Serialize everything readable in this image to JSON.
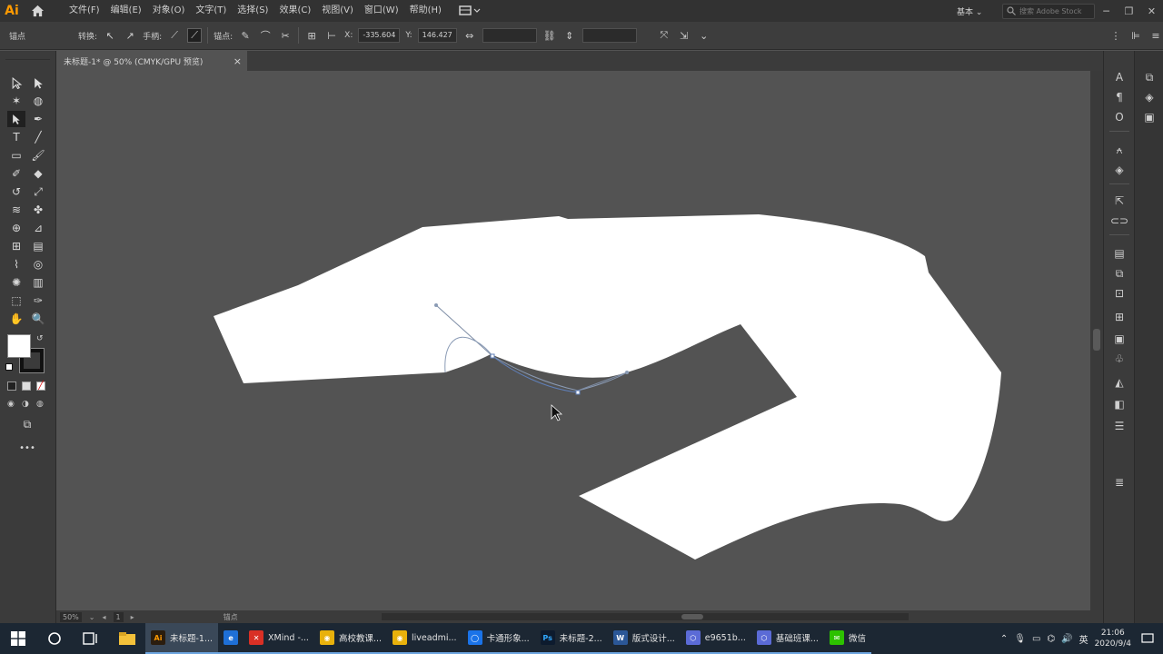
{
  "app": {
    "logo": "Ai",
    "menus": [
      "文件(F)",
      "编辑(E)",
      "对象(O)",
      "文字(T)",
      "选择(S)",
      "效果(C)",
      "视图(V)",
      "窗口(W)",
      "帮助(H)"
    ],
    "workspace": "基本",
    "search_placeholder": "搜索 Adobe Stock"
  },
  "control_bar": {
    "anchor_label": "锚点",
    "convert_label": "转换:",
    "handles_label": "手柄:",
    "anchor_points_label": "锚点:",
    "x_value": "-335.604",
    "y_value": "146.427"
  },
  "document": {
    "tab_title": "未标题-1* @ 50% (CMYK/GPU 预览)",
    "close_glyph": "×"
  },
  "status_bar": {
    "zoom": "50%",
    "artboard": "1",
    "tool_name": "锚点"
  },
  "taskbar": {
    "tasks": [
      {
        "label": "未标题-1...",
        "icon": "Ai",
        "color": "#2b1d0e",
        "text_color": "#ff9a00",
        "active": true
      },
      {
        "label": "",
        "icon": "e",
        "color": "#1e6fd6",
        "text_color": "#ffffff",
        "active": false
      },
      {
        "label": "XMind -...",
        "icon": "✕",
        "color": "#d93025",
        "text_color": "#ffffff",
        "active": false
      },
      {
        "label": "高校教课...",
        "icon": "◉",
        "color": "#e8b10c",
        "text_color": "#ffffff",
        "active": false
      },
      {
        "label": "liveadmi...",
        "icon": "◉",
        "color": "#e8b10c",
        "text_color": "#ffffff",
        "active": false
      },
      {
        "label": "卡通形象...",
        "icon": "◯",
        "color": "#1a73e8",
        "text_color": "#ffffff",
        "active": false
      },
      {
        "label": "未标题-2...",
        "icon": "Ps",
        "color": "#0d1b2e",
        "text_color": "#31a8ff",
        "active": false
      },
      {
        "label": "版式设计...",
        "icon": "W",
        "color": "#2b5797",
        "text_color": "#ffffff",
        "active": false
      },
      {
        "label": "e9651b...",
        "icon": "⬡",
        "color": "#5b6bd6",
        "text_color": "#ffffff",
        "active": false
      },
      {
        "label": "基础班课...",
        "icon": "⬡",
        "color": "#5b6bd6",
        "text_color": "#ffffff",
        "active": false
      },
      {
        "label": "微信",
        "icon": "✉",
        "color": "#2dc100",
        "text_color": "#ffffff",
        "active": false
      }
    ],
    "ime": "英",
    "time": "21:06",
    "date": "2020/9/4"
  },
  "icons": {
    "home": "home-icon",
    "search": "search-icon",
    "start": "windows-start-icon"
  }
}
